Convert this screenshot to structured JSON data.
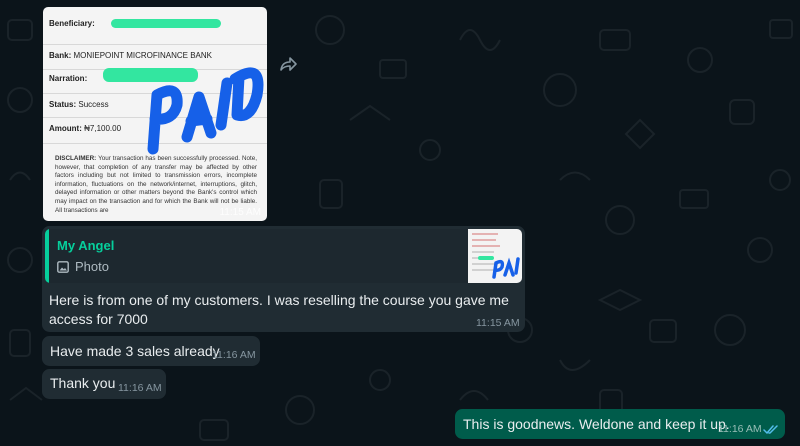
{
  "receipt": {
    "beneficiary_label": "Beneficiary:",
    "bank_label": "Bank:",
    "bank_value": "MONIEPOINT MICROFINANCE BANK",
    "narration_label": "Narration:",
    "status_label": "Status:",
    "status_value": "Success",
    "amount_label": "Amount:",
    "amount_value": "₦7,100.00",
    "disclaimer_label": "DISCLAIMER:",
    "disclaimer_text": "Your transaction has been successfully processed. Note, however, that completion of any transfer may be affected by other factors including but not limited to transmission errors, incomplete information, fluctuations on the network/internet, interruptions, glitch, delayed information or other matters beyond the Bank's control which may impact on the transaction and for which the Bank will not be liable. All transactions are",
    "stamp_text": "PAID",
    "time": "11:15 AM"
  },
  "quoted": {
    "author": "My Angel",
    "type": "Photo"
  },
  "messages": [
    {
      "text": "Here is from one of my customers. I was reselling the course you gave me access for 7000",
      "time": "11:15 AM"
    },
    {
      "text": "Have made 3 sales already",
      "time": "11:16 AM"
    },
    {
      "text": "Thank you",
      "time": "11:16 AM"
    }
  ],
  "outgoing": {
    "text": "This is goodnews. Weldone and keep it up.",
    "time": "11:16 AM",
    "status": "read"
  },
  "colors": {
    "background": "#0b141a",
    "incoming_bubble": "#202c33",
    "outgoing_bubble": "#005c4b",
    "accent": "#06cf9c",
    "read_ticks": "#53bdeb"
  }
}
